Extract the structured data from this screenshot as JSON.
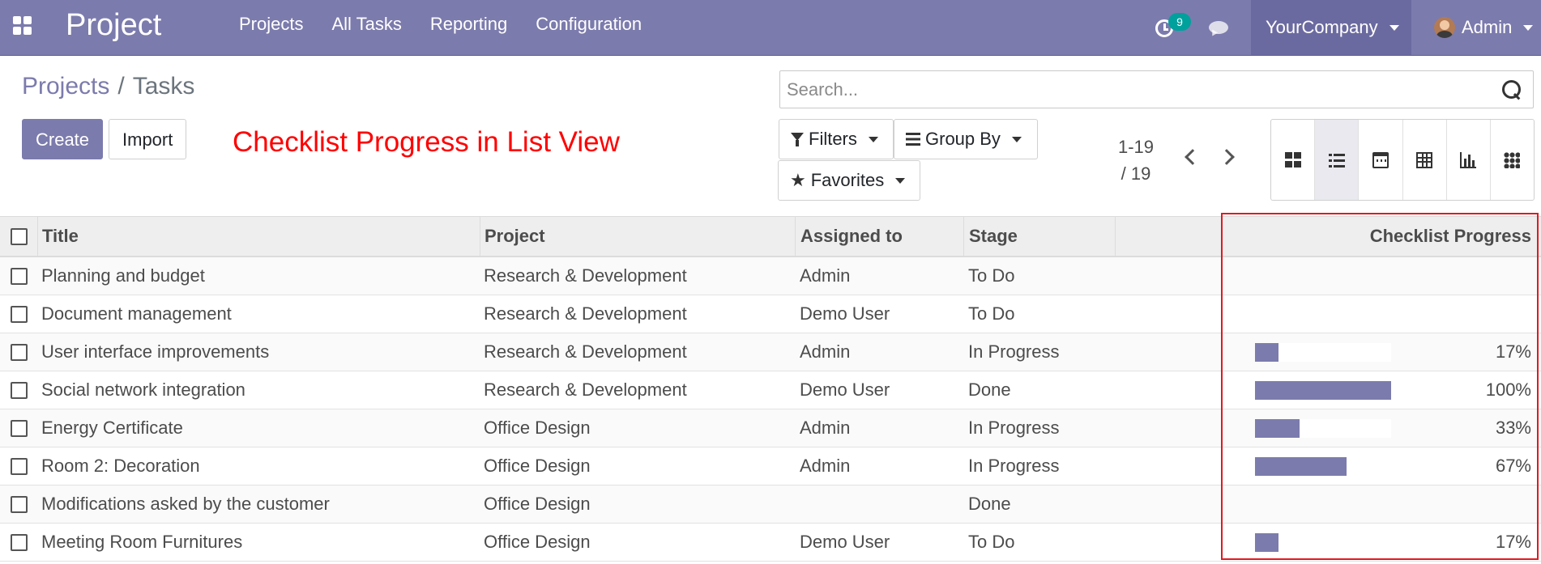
{
  "navbar": {
    "brand": "Project",
    "menu": [
      "Projects",
      "All Tasks",
      "Reporting",
      "Configuration"
    ],
    "activity_count": "9",
    "company": "YourCompany",
    "user": "Admin"
  },
  "breadcrumb": {
    "parent": "Projects",
    "separator": "/",
    "current": "Tasks"
  },
  "buttons": {
    "create": "Create",
    "import": "Import"
  },
  "annotation": "Checklist Progress in List View",
  "search": {
    "placeholder": "Search..."
  },
  "search_panel": {
    "filters": "Filters",
    "group_by": "Group By",
    "favorites": "Favorites"
  },
  "pager": {
    "range": "1-19",
    "total": "/ 19"
  },
  "views": [
    "kanban-icon",
    "list-icon",
    "calendar-icon",
    "pivot-icon",
    "graph-icon",
    "grid-icon"
  ],
  "active_view": "list",
  "colors": {
    "brand": "#7c7bad",
    "accent": "#00a09d",
    "highlight": "#e01a22",
    "annotation": "#ff0000"
  },
  "table": {
    "columns": {
      "title": "Title",
      "project": "Project",
      "assigned": "Assigned to",
      "stage": "Stage",
      "progress": "Checklist Progress"
    },
    "rows": [
      {
        "title": "Planning and budget",
        "project": "Research & Development",
        "assigned": "Admin",
        "stage": "To Do",
        "progress": null,
        "progress_label": ""
      },
      {
        "title": "Document management",
        "project": "Research & Development",
        "assigned": "Demo User",
        "stage": "To Do",
        "progress": null,
        "progress_label": ""
      },
      {
        "title": "User interface improvements",
        "project": "Research & Development",
        "assigned": "Admin",
        "stage": "In Progress",
        "progress": 17,
        "progress_label": "17%"
      },
      {
        "title": "Social network integration",
        "project": "Research & Development",
        "assigned": "Demo User",
        "stage": "Done",
        "progress": 100,
        "progress_label": "100%"
      },
      {
        "title": "Energy Certificate",
        "project": "Office Design",
        "assigned": "Admin",
        "stage": "In Progress",
        "progress": 33,
        "progress_label": "33%"
      },
      {
        "title": "Room 2: Decoration",
        "project": "Office Design",
        "assigned": "Admin",
        "stage": "In Progress",
        "progress": 67,
        "progress_label": "67%"
      },
      {
        "title": "Modifications asked by the customer",
        "project": "Office Design",
        "assigned": "",
        "stage": "Done",
        "progress": null,
        "progress_label": ""
      },
      {
        "title": "Meeting Room Furnitures",
        "project": "Office Design",
        "assigned": "Demo User",
        "stage": "To Do",
        "progress": 17,
        "progress_label": "17%"
      }
    ]
  }
}
